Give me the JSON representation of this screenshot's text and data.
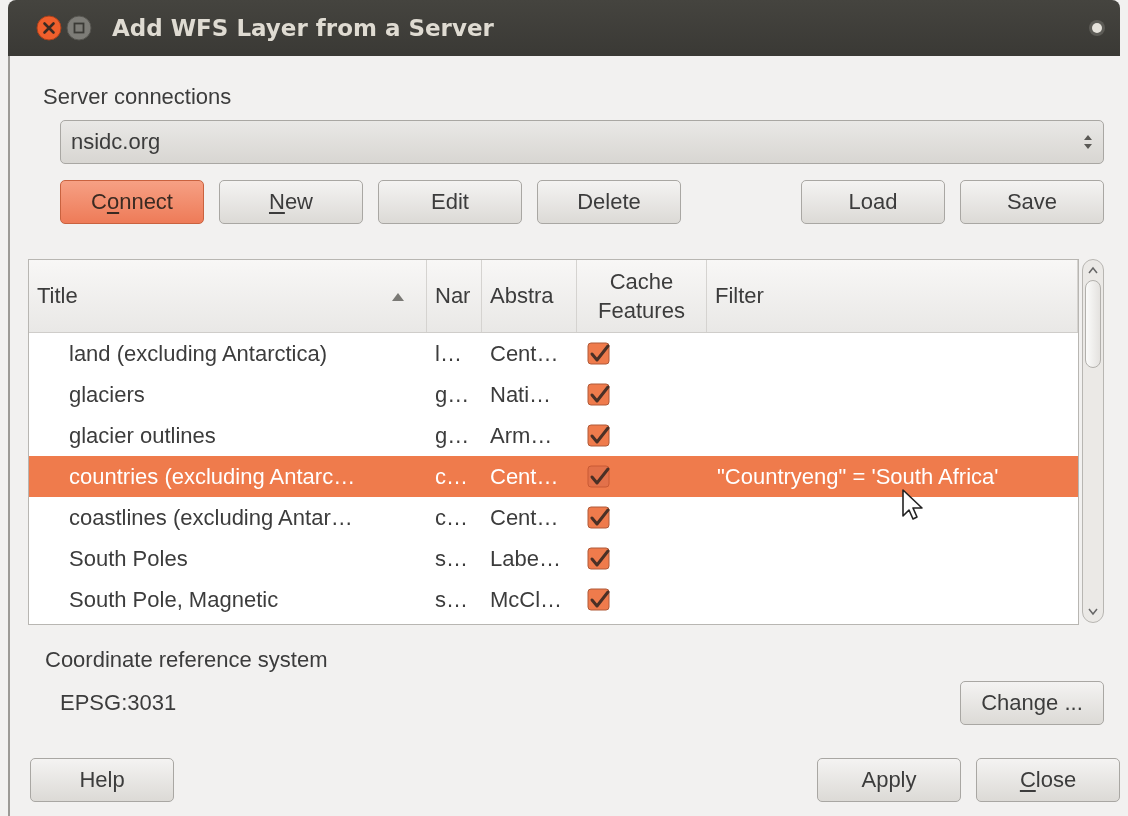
{
  "window": {
    "title": "Add WFS Layer from a Server"
  },
  "server_connections": {
    "label": "Server connections",
    "value": "nsidc.org"
  },
  "connection_buttons": {
    "left": [
      {
        "before": "C",
        "key": "o",
        "after": "nnect",
        "highlighted": true
      },
      {
        "key": "N",
        "after": "ew",
        "highlighted": false
      },
      {
        "before": "Edit",
        "highlighted": false
      },
      {
        "before": "Delete",
        "highlighted": false
      }
    ],
    "right": [
      {
        "before": "Load",
        "highlighted": false
      },
      {
        "before": "Save",
        "highlighted": false
      }
    ]
  },
  "table": {
    "columns": [
      {
        "label": "Title",
        "sorted": true
      },
      {
        "label": "Nar",
        "sorted": false
      },
      {
        "label": "Abstra",
        "sorted": false
      },
      {
        "label": "Cache Features",
        "sorted": false
      },
      {
        "label": "Filter",
        "sorted": false
      }
    ],
    "rows": [
      {
        "title": "land (excluding Antarctica)",
        "name": "l…",
        "abstract": "Cent…",
        "cache": true,
        "selected": false
      },
      {
        "title": "glaciers",
        "name": "g…",
        "abstract": "Nati…",
        "cache": true,
        "selected": false
      },
      {
        "title": "glacier outlines",
        "name": "g…",
        "abstract": "Arm…",
        "cache": true,
        "selected": false
      },
      {
        "title": "countries (excluding Antarc…",
        "name": "c…",
        "abstract": "Cent…",
        "cache": true,
        "filter": "\"Countryeng\" = 'South Africa'",
        "selected": true
      },
      {
        "title": "coastlines (excluding Antar…",
        "name": "c…",
        "abstract": "Cent…",
        "cache": true,
        "selected": false
      },
      {
        "title": "South Poles",
        "name": "s…",
        "abstract": "Labe…",
        "cache": true,
        "selected": false
      },
      {
        "title": "South Pole, Magnetic",
        "name": "s…",
        "abstract": "McCl…",
        "cache": true,
        "selected": false
      }
    ]
  },
  "crs": {
    "label": "Coordinate reference system",
    "value": "EPSG:3031",
    "button": {
      "before": "Change ...",
      "highlighted": false
    }
  },
  "footer_buttons": {
    "left": [
      {
        "before": "Help",
        "highlighted": false
      }
    ],
    "right": [
      {
        "before": "Apply",
        "highlighted": false
      },
      {
        "key": "C",
        "after": "lose",
        "highlighted": false
      }
    ]
  }
}
